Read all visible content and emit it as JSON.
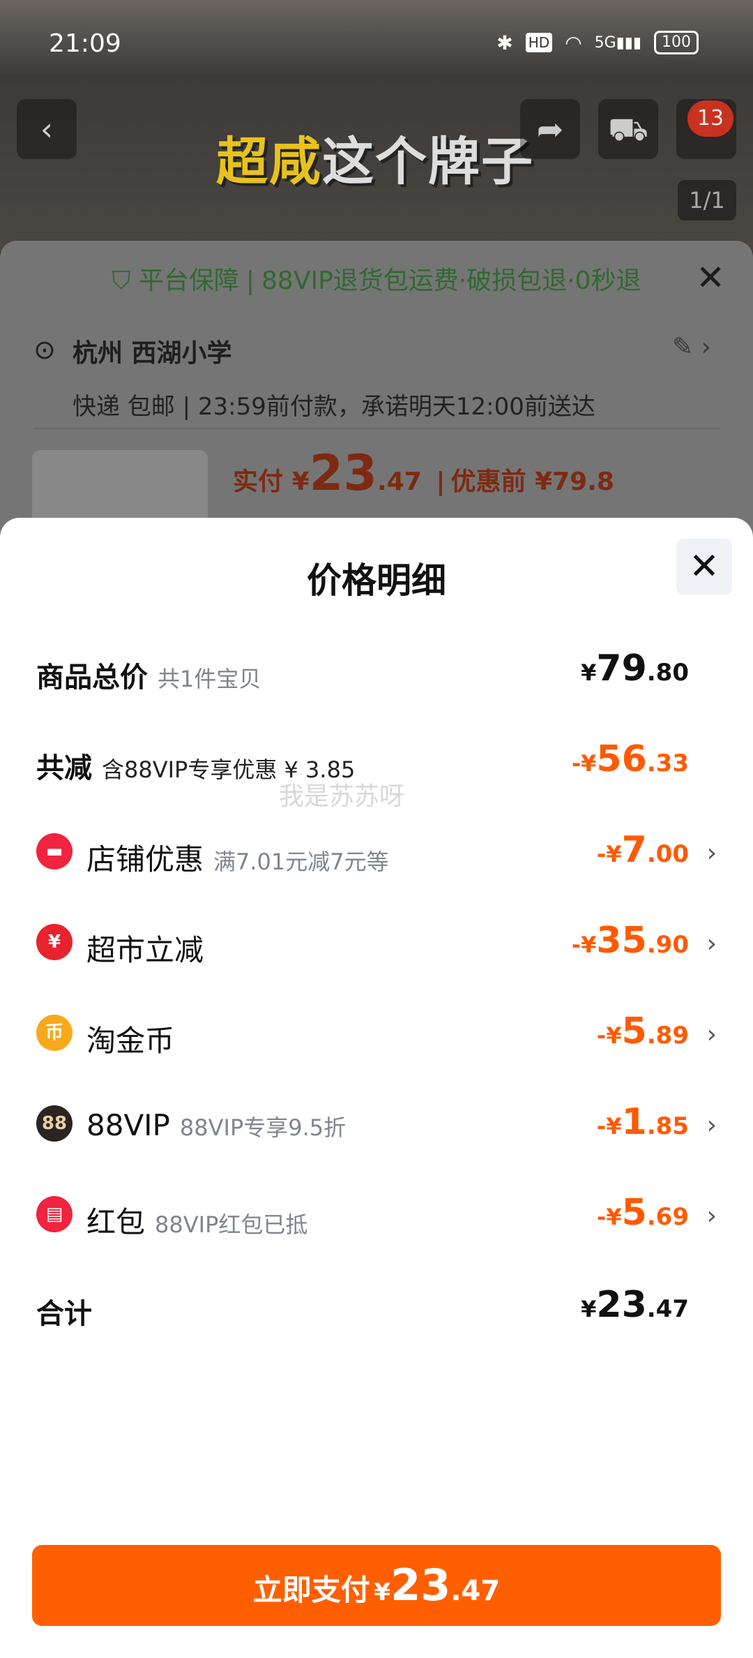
{
  "status_bar": {
    "time": "21:09",
    "battery": "100",
    "network": "5G",
    "hd": "HD"
  },
  "background": {
    "banner_title_highlight": "超咸",
    "banner_title_rest": "这个牌子",
    "cart_badge": "13",
    "pager": "1/1"
  },
  "order": {
    "guarantee": "平台保障",
    "guarantee_detail": "88VIP退货包运费·破损包退·0秒退",
    "address": "杭州 西湖小学",
    "delivery_method": "快递 包邮",
    "delivery_promise": "23:59前付款，承诺明天12:00前送达",
    "paid_label": "实付",
    "paid_currency": "¥",
    "paid_int": "23",
    "paid_dec": ".47",
    "before_discount": "优惠前 ¥79.8"
  },
  "sheet": {
    "title": "价格明细",
    "watermark": "我是苏苏呀",
    "rows": [
      {
        "label": "商品总价",
        "note": "共1件宝贝",
        "cur": "¥",
        "int": "79",
        "dec": ".80"
      },
      {
        "label": "共减",
        "note": "含88VIP专享优惠 ¥ 3.85",
        "cur": "-¥",
        "int": "56",
        "dec": ".33"
      },
      {
        "label": "店铺优惠",
        "note": "满7.01元减7元等",
        "cur": "-¥",
        "int": "7",
        "dec": ".00"
      },
      {
        "label": "超市立减",
        "note": "",
        "cur": "-¥",
        "int": "35",
        "dec": ".90"
      },
      {
        "label": "淘金币",
        "note": "",
        "cur": "-¥",
        "int": "5",
        "dec": ".89"
      },
      {
        "label": "88VIP",
        "note": "88VIP专享9.5折",
        "cur": "-¥",
        "int": "1",
        "dec": ".85"
      },
      {
        "label": "红包",
        "note": "88VIP红包已抵",
        "cur": "-¥",
        "int": "5",
        "dec": ".69"
      },
      {
        "label": "合计",
        "note": "",
        "cur": "¥",
        "int": "23",
        "dec": ".47"
      }
    ],
    "icon_88": "88",
    "icon_coin": "币",
    "icon_tm": "¥"
  },
  "pay_button": {
    "label": "立即支付",
    "cur": "¥",
    "int": "23",
    "dec": ".47"
  },
  "colors": {
    "accent": "#ff5f00",
    "price_orange": "#ff5a00",
    "shop_red": "#f0243f"
  }
}
